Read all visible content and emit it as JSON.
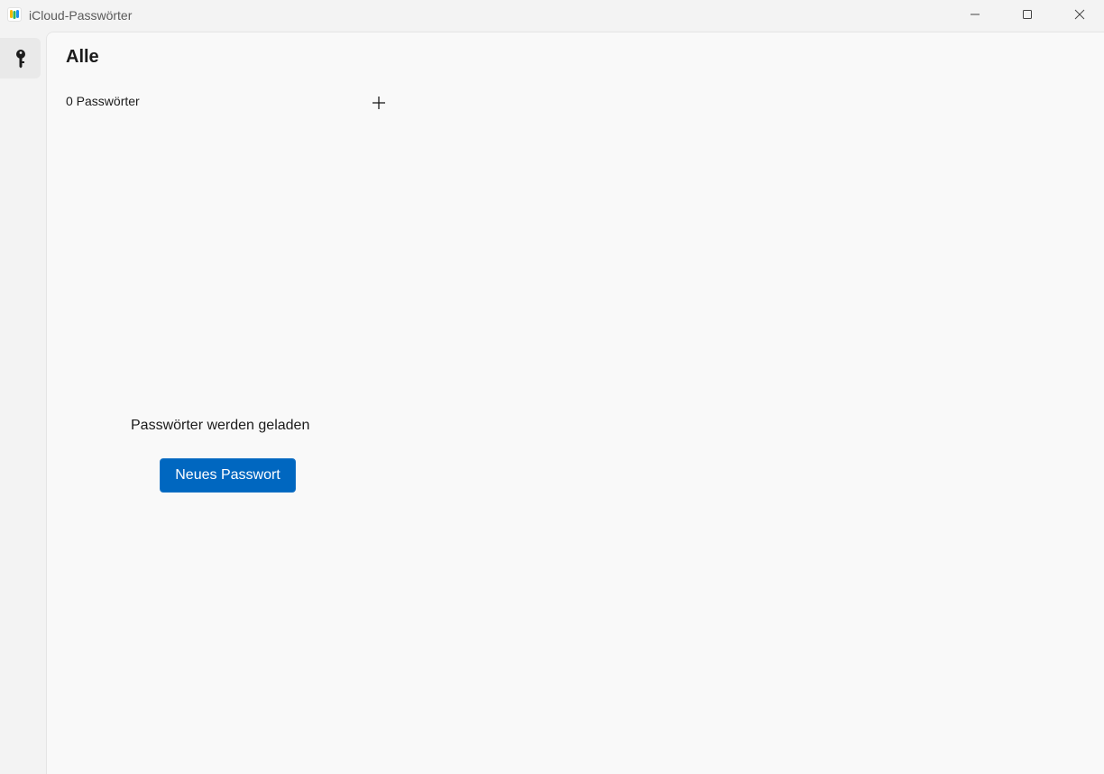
{
  "window": {
    "title": "iCloud-Passwörter",
    "controls": [
      "minimize-icon",
      "maximize-icon",
      "close-icon"
    ]
  },
  "sidebar": {
    "items": [
      {
        "icon": "key-icon",
        "selected": true
      }
    ]
  },
  "main": {
    "title": "Alle",
    "count_label": "0 Passwörter",
    "add_icon": "plus-icon",
    "empty_state": {
      "message": "Passwörter werden geladen",
      "button_label": "Neues Passwort"
    }
  },
  "colors": {
    "accent": "#0067c0",
    "content_bg": "#f9f9f9",
    "chrome_bg": "#f3f3f3",
    "selected_bg": "#e9e9e9"
  }
}
